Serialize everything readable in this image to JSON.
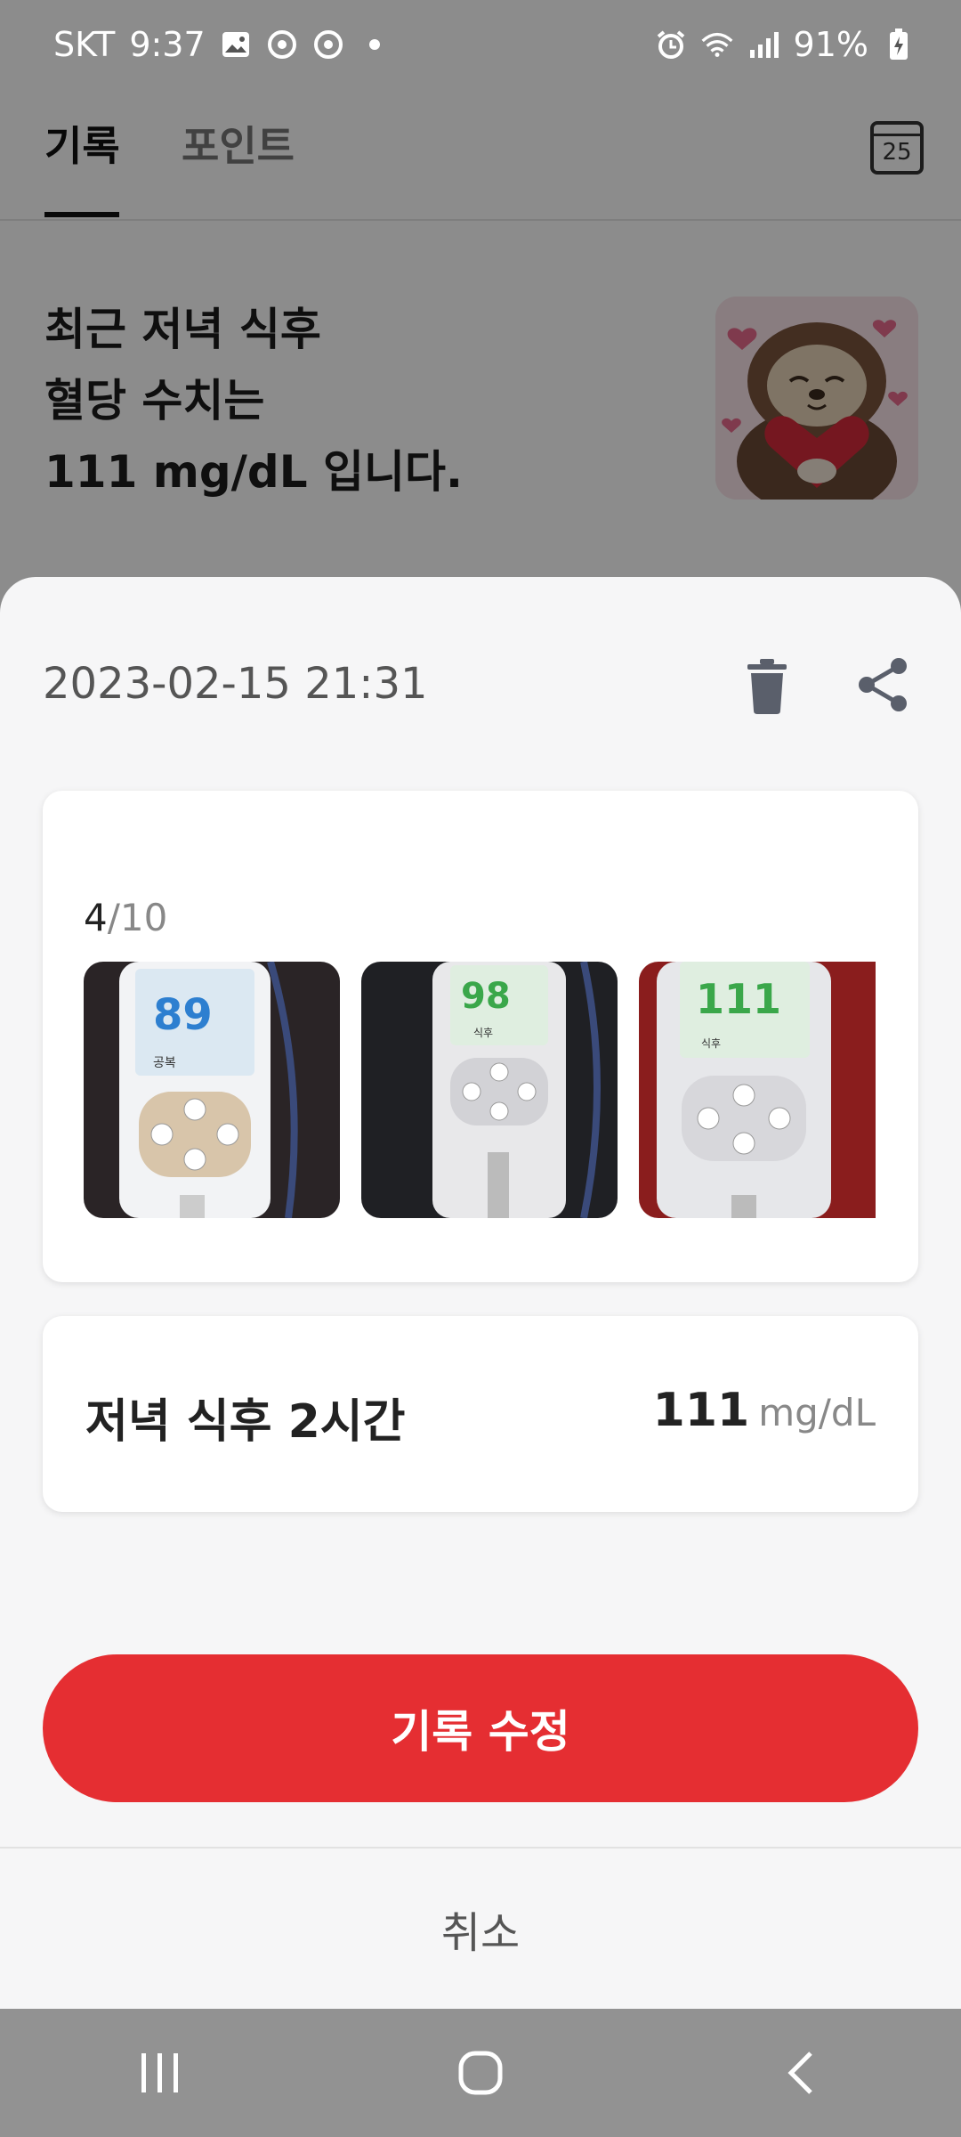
{
  "status_bar": {
    "carrier": "SKT",
    "time": "9:37",
    "battery": "91%",
    "icons": [
      "gallery-icon",
      "app-notification-icon",
      "app-notification-icon",
      "dot-icon",
      "alarm-icon",
      "wifi-icon",
      "signal-icon",
      "battery-charging-icon"
    ]
  },
  "header": {
    "tabs": [
      {
        "label": "기록",
        "active": true
      },
      {
        "label": "포인트",
        "active": false
      }
    ],
    "calendar_day": "25"
  },
  "summary": {
    "line1": "최근 저녁 식후",
    "line2": "혈당 수치는",
    "line3": "111 mg/dL 입니다."
  },
  "sheet": {
    "datetime": "2023-02-15 21:31",
    "photo_counter_current": "4",
    "photo_counter_total": "/10",
    "photos": [
      {
        "reading": "89",
        "caption": "공복",
        "reading_color": "#2d7fd0"
      },
      {
        "reading": "98",
        "caption": "식후",
        "reading_color": "#3aa74a"
      },
      {
        "reading": "111",
        "caption": "식후",
        "reading_color": "#3aa74a"
      }
    ],
    "reading": {
      "label": "저녁 식후 2시간",
      "value": "111",
      "unit": "mg/dL"
    },
    "edit_button": "기록 수정",
    "cancel_button": "취소"
  },
  "colors": {
    "accent": "#e52e32",
    "sheet_bg": "#f6f6f7"
  }
}
